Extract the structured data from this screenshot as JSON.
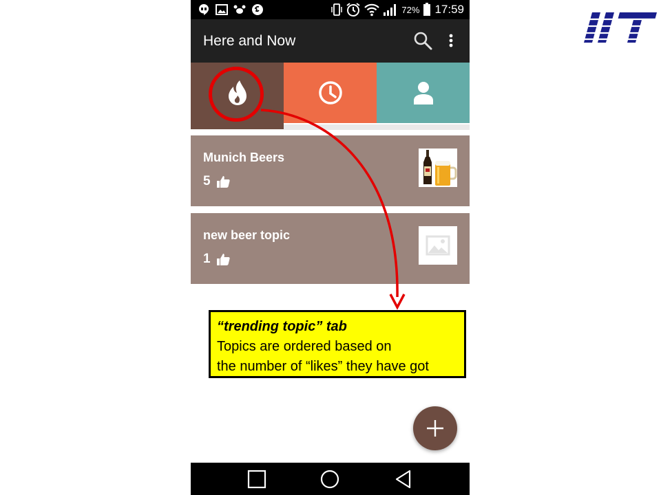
{
  "status_bar": {
    "battery_percent": "72%",
    "time": "17:59"
  },
  "app_bar": {
    "title": "Here and Now",
    "search_icon": "search-icon",
    "menu_icon": "more-vert-icon"
  },
  "tabs": [
    {
      "name": "trending",
      "icon": "flame-icon",
      "color": "#6d4c41",
      "selected": true
    },
    {
      "name": "recent",
      "icon": "clock-icon",
      "color": "#ee6c46"
    },
    {
      "name": "mine",
      "icon": "person-icon",
      "color": "#64aca8"
    }
  ],
  "topics": [
    {
      "title": "Munich Beers",
      "likes": "5",
      "thumbnail": "beer-photo"
    },
    {
      "title": "new beer topic",
      "likes": "1",
      "thumbnail": "image-placeholder-icon"
    }
  ],
  "fab": {
    "icon": "plus-icon"
  },
  "nav_bar": {
    "buttons": [
      "recents-icon",
      "home-icon",
      "back-icon"
    ]
  },
  "annotation": {
    "title": "“trending topic” tab",
    "line1": "Topics are ordered based on",
    "line2": "the number of “likes” they have got",
    "color": "#e30000",
    "box_color": "#ffff00"
  },
  "colors": {
    "card": "#9b857d",
    "app_bar": "#212121",
    "accent": "#6d4c41"
  }
}
